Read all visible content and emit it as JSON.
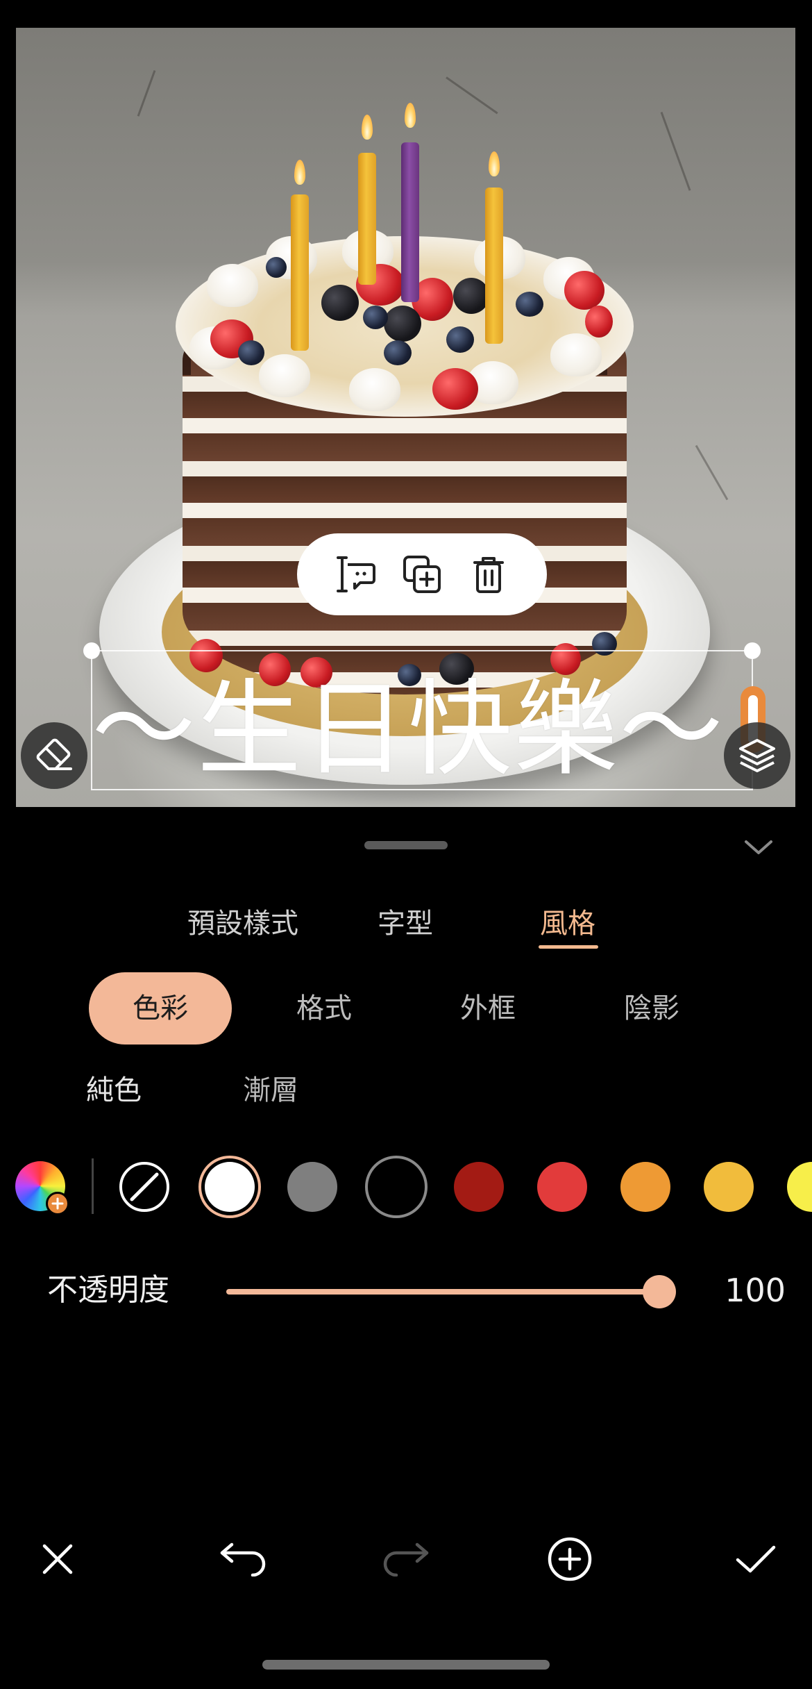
{
  "canvas": {
    "text_overlay": "～生日快樂～",
    "toolbar": {
      "edit_icon": "text-cursor-icon",
      "duplicate_icon": "duplicate-icon",
      "delete_icon": "trash-icon"
    },
    "eraser_icon": "eraser-icon",
    "layers_icon": "layers-icon"
  },
  "panel": {
    "main_tabs": [
      {
        "label": "預設樣式",
        "active": false
      },
      {
        "label": "字型",
        "active": false
      },
      {
        "label": "風格",
        "active": true
      }
    ],
    "sub_tabs": [
      {
        "label": "色彩",
        "active": true
      },
      {
        "label": "格式",
        "active": false
      },
      {
        "label": "外框",
        "active": false
      },
      {
        "label": "陰影",
        "active": false
      }
    ],
    "fill_types": [
      {
        "label": "純色",
        "active": true
      },
      {
        "label": "漸層",
        "active": false
      }
    ],
    "swatches": [
      {
        "name": "none",
        "color": "none"
      },
      {
        "name": "white",
        "color": "#ffffff",
        "selected": true
      },
      {
        "name": "gray",
        "color": "#7f7f7f"
      },
      {
        "name": "black",
        "color": "#000000"
      },
      {
        "name": "dark-red",
        "color": "#a31b14"
      },
      {
        "name": "red",
        "color": "#e23b3b"
      },
      {
        "name": "orange",
        "color": "#ee9a34"
      },
      {
        "name": "yellow-orange",
        "color": "#f1bc3c"
      },
      {
        "name": "yellow",
        "color": "#f7ee4a"
      }
    ],
    "opacity": {
      "label": "不透明度",
      "value": "100",
      "fraction": 1.0
    }
  },
  "bottom_bar": {
    "close_icon": "close-icon",
    "undo_icon": "undo-icon",
    "redo_icon": "redo-icon",
    "add_icon": "add-circle-icon",
    "confirm_icon": "check-icon"
  },
  "colors": {
    "accent": "#f3b898",
    "tab_active": "#f3b98f",
    "handle_orange": "#e98a3c"
  }
}
